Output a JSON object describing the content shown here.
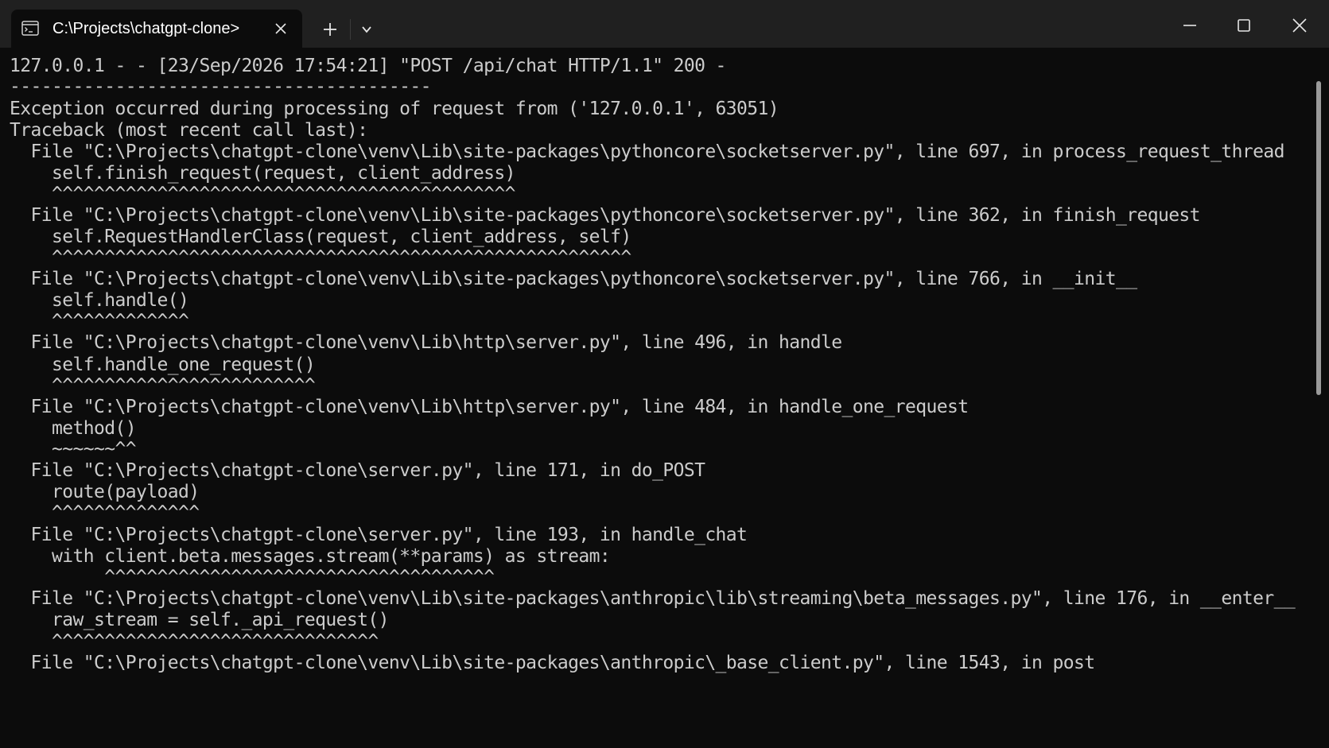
{
  "tab": {
    "title": "C:\\Projects\\chatgpt-clone>",
    "icon": "terminal-icon"
  },
  "titlebar_icons": {
    "new_tab": "plus-icon",
    "dropdown": "chevron-down-icon",
    "minimize": "minimize-icon",
    "maximize": "maximize-icon",
    "close": "close-icon"
  },
  "console": {
    "lines": [
      "127.0.0.1 - - [23/Sep/2026 17:54:21] \"POST /api/chat HTTP/1.1\" 200 -",
      "----------------------------------------",
      "Exception occurred during processing of request from ('127.0.0.1', 63051)",
      "Traceback (most recent call last):",
      "  File \"C:\\Projects\\chatgpt-clone\\venv\\Lib\\site-packages\\pythoncore\\socketserver.py\", line 697, in process_request_thread",
      "    self.finish_request(request, client_address)",
      "    ^^^^^^^^^^^^^^^^^^^^^^^^^^^^^^^^^^^^^^^^^^^^",
      "  File \"C:\\Projects\\chatgpt-clone\\venv\\Lib\\site-packages\\pythoncore\\socketserver.py\", line 362, in finish_request",
      "    self.RequestHandlerClass(request, client_address, self)",
      "    ^^^^^^^^^^^^^^^^^^^^^^^^^^^^^^^^^^^^^^^^^^^^^^^^^^^^^^^",
      "  File \"C:\\Projects\\chatgpt-clone\\venv\\Lib\\site-packages\\pythoncore\\socketserver.py\", line 766, in __init__",
      "    self.handle()",
      "    ^^^^^^^^^^^^^",
      "  File \"C:\\Projects\\chatgpt-clone\\venv\\Lib\\http\\server.py\", line 496, in handle",
      "    self.handle_one_request()",
      "    ^^^^^^^^^^^^^^^^^^^^^^^^^",
      "  File \"C:\\Projects\\chatgpt-clone\\venv\\Lib\\http\\server.py\", line 484, in handle_one_request",
      "    method()",
      "    ~~~~~~^^",
      "  File \"C:\\Projects\\chatgpt-clone\\server.py\", line 171, in do_POST",
      "    route(payload)",
      "    ^^^^^^^^^^^^^^",
      "  File \"C:\\Projects\\chatgpt-clone\\server.py\", line 193, in handle_chat",
      "    with client.beta.messages.stream(**params) as stream:",
      "         ^^^^^^^^^^^^^^^^^^^^^^^^^^^^^^^^^^^^^",
      "  File \"C:\\Projects\\chatgpt-clone\\venv\\Lib\\site-packages\\anthropic\\lib\\streaming\\beta_messages.py\", line 176, in __enter__",
      "    raw_stream = self._api_request()",
      "    ^^^^^^^^^^^^^^^^^^^^^^^^^^^^^^^",
      "  File \"C:\\Projects\\chatgpt-clone\\venv\\Lib\\site-packages\\anthropic\\_base_client.py\", line 1543, in post"
    ]
  }
}
